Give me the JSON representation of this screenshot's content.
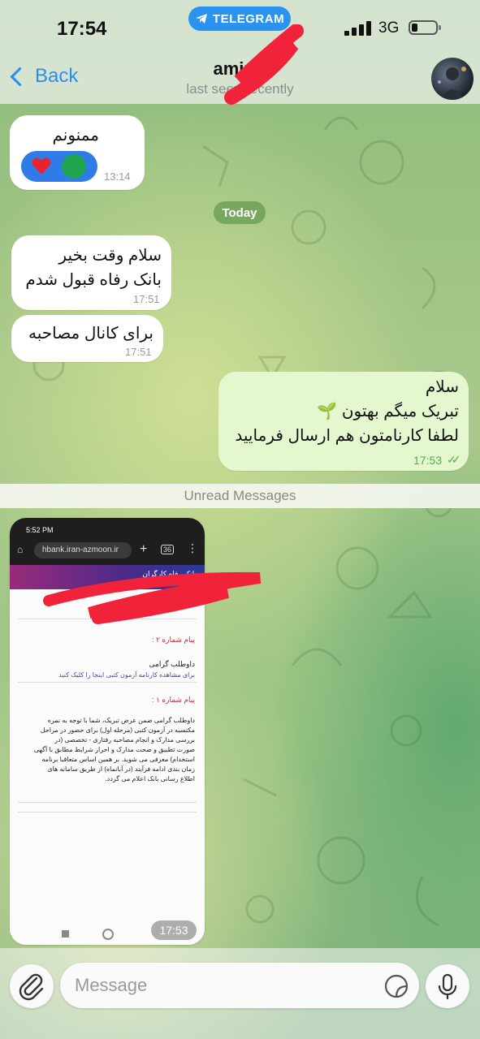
{
  "status_bar": {
    "time": "17:54",
    "app_pill": "TELEGRAM",
    "network": "3G"
  },
  "header": {
    "back_label": "Back",
    "contact_name": "amir n",
    "last_seen": "last seen recently"
  },
  "messages": [
    {
      "text": "ممنونم",
      "time": "13:14",
      "direction": "in"
    },
    {
      "text": "سلام وقت بخیر\nبانک رفاه قبول شدم",
      "time": "17:51",
      "direction": "in"
    },
    {
      "text": "برای کانال مصاحبه",
      "time": "17:51",
      "direction": "in"
    },
    {
      "text": "سلام\nتبریک میگم بهتون 🌱\nلطفا کارنامتون هم ارسال فرمایید",
      "time": "17:53",
      "direction": "out"
    }
  ],
  "date_separator": "Today",
  "unread_separator": "Unread Messages",
  "photo": {
    "time": "17:53",
    "screenshot": {
      "status_time": "5:52 PM",
      "url": "hbank.iran-azmoon.ir",
      "tab_count": "36",
      "bank_name": "بانک رفاه کارگران",
      "message2_title": "پیام شماره ۲ :",
      "message2_greeting": "داوطلب گرامی",
      "message2_link": "برای مشاهده کارنامه آزمون کتبی اینجا را کلیک کنید",
      "message1_title": "پیام شماره ۱ :",
      "message1_body": "داوطلب گرامی ضمن عرض تبریک، شما با توجه به نمره\nمکتسبه در آزمون کتبی (مرحله اول) برای حضور در مراحل\nبررسی مدارک و انجام مصاحبه رفتاری - تخصصی (در\nصورت تطبیق و صحت مدارک و احراز شرایط مطابق با آگهی\nاستخدام) معرفی می شوید. بر همین اساس متعاقبا برنامه\nزمان بندی ادامه فرآیند (در آبانماه) از طریق سامانه های\nاطلاع رسانی بانک اعلام می گردد."
    }
  },
  "composer": {
    "placeholder": "Message"
  },
  "colors": {
    "accent": "#2a8ef0",
    "outgoing_bubble": "#e4f7cf",
    "read_ticks": "#4fae4e"
  }
}
